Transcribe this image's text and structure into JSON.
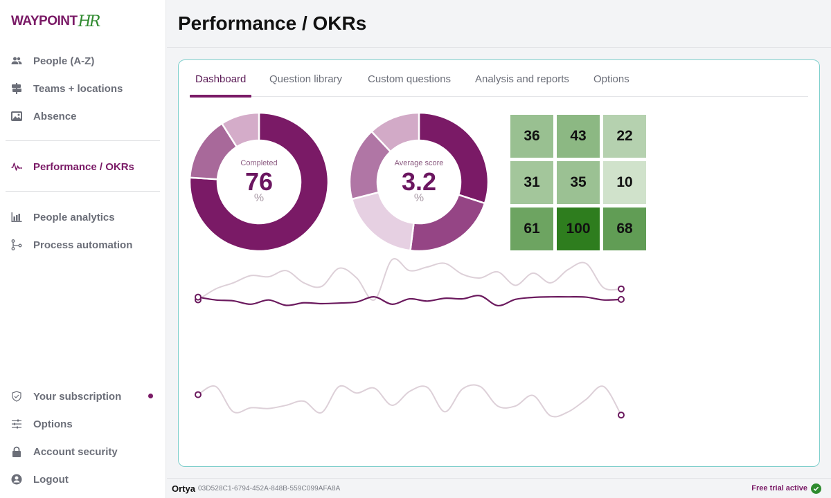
{
  "brand": {
    "name": "WAYPOINT",
    "suffix": "HR",
    "primary_color": "#7a1a66",
    "accent_color": "#2f8a2f"
  },
  "sidebar": {
    "items": [
      {
        "label": "People (A-Z)",
        "icon": "people-icon"
      },
      {
        "label": "Teams + locations",
        "icon": "signpost-icon"
      },
      {
        "label": "Absence",
        "icon": "image-icon"
      },
      {
        "label": "Performance / OKRs",
        "icon": "pulse-icon",
        "active": true
      },
      {
        "label": "People analytics",
        "icon": "bar-chart-icon"
      },
      {
        "label": "Process automation",
        "icon": "flow-icon"
      },
      {
        "label": "Your subscription",
        "icon": "shield-check-icon",
        "notification": true
      },
      {
        "label": "Options",
        "icon": "sliders-icon"
      },
      {
        "label": "Account security",
        "icon": "lock-icon"
      },
      {
        "label": "Logout",
        "icon": "user-circle-icon"
      }
    ]
  },
  "header": {
    "title": "Performance / OKRs"
  },
  "tabs": [
    {
      "label": "Dashboard",
      "active": true
    },
    {
      "label": "Question library"
    },
    {
      "label": "Custom questions"
    },
    {
      "label": "Analysis and reports"
    },
    {
      "label": "Options"
    }
  ],
  "chart_data": [
    {
      "type": "pie",
      "title": "Completed",
      "center_value": "76",
      "center_unit": "%",
      "slices": [
        {
          "value": 76,
          "color": "#7a1a66"
        },
        {
          "value": 15,
          "color": "#a8699a"
        },
        {
          "value": 9,
          "color": "#d4acc9"
        }
      ]
    },
    {
      "type": "pie",
      "title": "Average score",
      "center_value": "3.2",
      "center_unit": "%",
      "slices": [
        {
          "value": 30,
          "color": "#7a1a66"
        },
        {
          "value": 22,
          "color": "#954585"
        },
        {
          "value": 19,
          "color": "#e6d0e2"
        },
        {
          "value": 17,
          "color": "#b076a5"
        },
        {
          "value": 12,
          "color": "#d2aac7"
        }
      ]
    },
    {
      "type": "heatmap",
      "rows": [
        [
          36,
          43,
          22
        ],
        [
          31,
          35,
          10
        ],
        [
          61,
          100,
          68
        ]
      ],
      "range": [
        0,
        100
      ],
      "color_low": "#eef5ec",
      "color_high": "#2e7d1e"
    },
    {
      "type": "line",
      "x": [
        1,
        2,
        3,
        4,
        5,
        6,
        7,
        8,
        9,
        10,
        11,
        12,
        13,
        14,
        15,
        16,
        17,
        18,
        19,
        20,
        21,
        22,
        23,
        24,
        25
      ],
      "ylim": [
        0,
        100
      ],
      "series": [
        {
          "name": "series-1",
          "color": "#ddd0d8",
          "values": [
            69,
            78,
            83,
            89,
            88,
            93,
            83,
            80,
            95,
            87,
            69,
            102,
            93,
            96,
            99,
            90,
            87,
            92,
            81,
            91,
            83,
            94,
            99,
            79,
            78
          ]
        },
        {
          "name": "series-2",
          "color": "#6b1a5e",
          "values": [
            62,
            52,
            49,
            37,
            52,
            33,
            42,
            39,
            41,
            45,
            63,
            37,
            56,
            48,
            58,
            56,
            67,
            32,
            54,
            61,
            63,
            63,
            62,
            52,
            54
          ]
        },
        {
          "name": "series-3",
          "color": "#ddd0d8",
          "values": [
            19,
            29,
            -2,
            3,
            2,
            6,
            11,
            -3,
            29,
            21,
            27,
            6,
            23,
            28,
            -2,
            26,
            29,
            5,
            5,
            18,
            -7,
            -2,
            13,
            29,
            -6
          ]
        }
      ]
    }
  ],
  "footer": {
    "user": "Ortya",
    "id": "03D528C1-6794-452A-848B-559C099AFA8A",
    "status": "Free trial active"
  }
}
